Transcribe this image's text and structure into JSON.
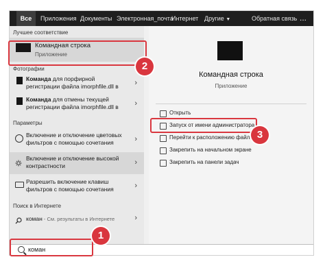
{
  "nav": {
    "tabs": [
      "Все",
      "Приложения",
      "Документы",
      "Электронная_почта",
      "Интернет",
      "Другие"
    ],
    "feedback": "Обратная связь",
    "more": "..."
  },
  "left": {
    "best_match_header": "Лучшее соответствие",
    "best": {
      "title": "Командная строка",
      "type": "Приложение"
    },
    "photos_header": "Фотографии",
    "photos": [
      {
        "bold": "Команда",
        "rest": " для порфирной",
        "line2": "регистрации файла imorphfile.dll в"
      },
      {
        "bold": "Команда",
        "rest": " для отмены текущей",
        "line2": "регистрации файла imorphfile.dll в"
      }
    ],
    "params_header": "Параметры",
    "params": [
      {
        "line1": "Включение и отключение цветовых",
        "line2": "фильтров с помощью сочетания"
      },
      {
        "line1": "Включение и отключение высокой",
        "line2": "контрастности"
      },
      {
        "line1": "Разрешить включение клавиш",
        "line2": "фильтров с помощью сочетания"
      }
    ],
    "web_header": "Поиск в Интернете",
    "web": {
      "query": "коман",
      "suffix": " - См. результаты в Интернете"
    }
  },
  "right": {
    "title": "Командная строка",
    "subtitle": "Приложение",
    "actions": [
      "Открыть",
      "Запуск от имени администратора",
      "Перейти к расположению файла",
      "Закрепить на начальном экране",
      "Закрепить на панели задач"
    ]
  },
  "search": {
    "value": "коман"
  },
  "badges": [
    "1",
    "2",
    "3"
  ],
  "colors": {
    "accent_red": "#d9363e",
    "topbar": "#1f1f1f"
  }
}
